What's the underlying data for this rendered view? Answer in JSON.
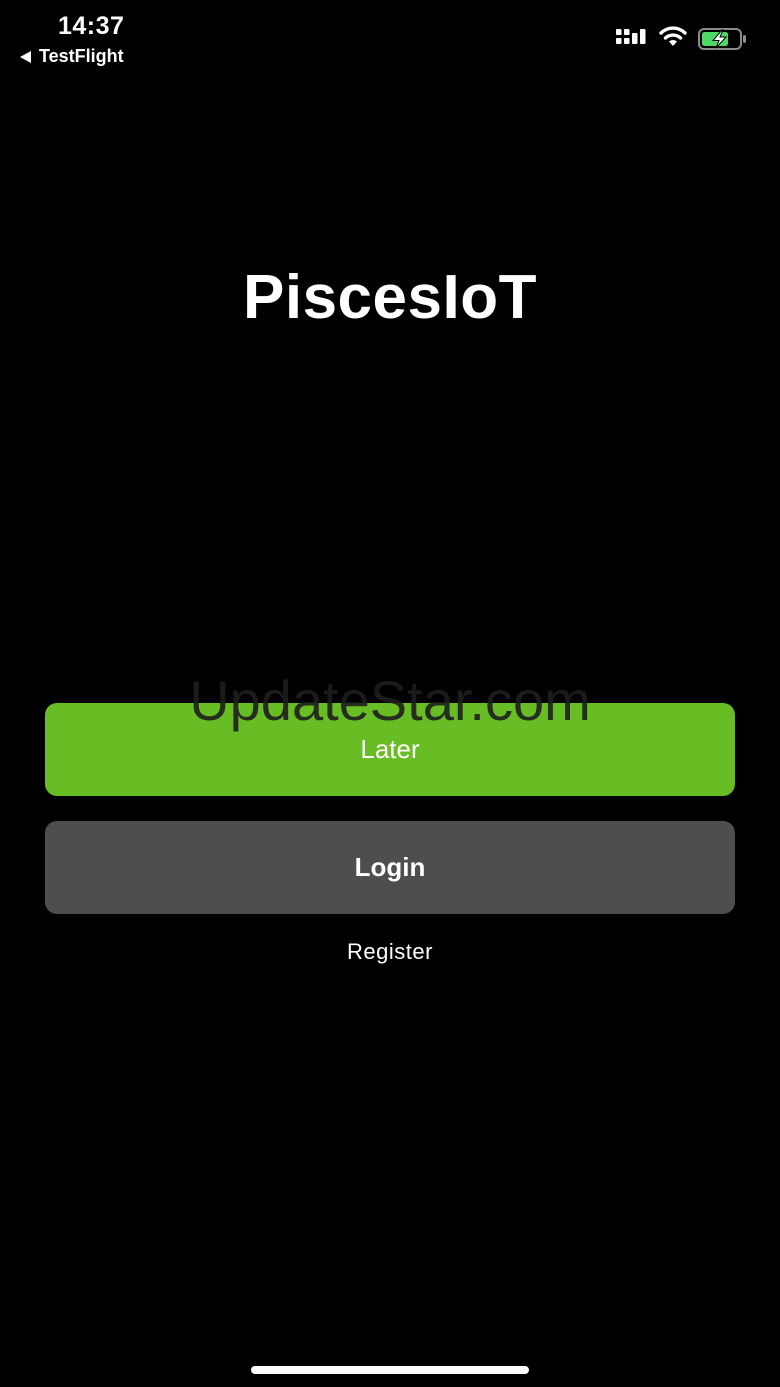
{
  "status_bar": {
    "time": "14:37",
    "back_label": "TestFlight",
    "battery_color": "#4cd964",
    "icons": [
      "signal-icon",
      "wifi-icon",
      "battery-charging-icon"
    ]
  },
  "app": {
    "title": "PiscesIoT"
  },
  "actions": {
    "later_label": "Later",
    "login_label": "Login",
    "register_label": "Register"
  },
  "watermark": {
    "text": "UpdateStar.com"
  },
  "colors": {
    "background": "#000000",
    "later_button": "#68bd25",
    "login_button": "#4e4e4e"
  }
}
